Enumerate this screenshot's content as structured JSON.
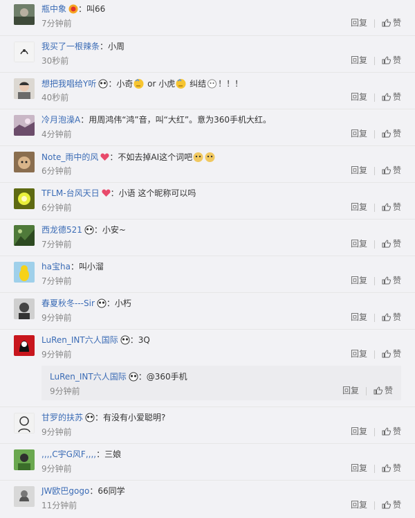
{
  "comments": [
    {
      "user": "瓶中象",
      "badge": "vip",
      "text": "：叫66",
      "time": "7分钟前"
    },
    {
      "user": "我买了一根辣条",
      "badge": "",
      "text": "：小周",
      "time": "30秒前"
    },
    {
      "user": "想把我唱给Y听",
      "badge": "panda",
      "text": "：小奇",
      "text2": " or 小虎",
      "text3": " 纠结",
      "text4": "！！！",
      "time": "40秒前"
    },
    {
      "user": "冷月泡澡A",
      "badge": "",
      "text": "：用周鸿伟“鸿”音，叫“大红”。意为360手机大红。",
      "time": "4分钟前"
    },
    {
      "user": "Note_雨中的风",
      "badge": "heart",
      "text": "：不如去掉AI这个词吧",
      "time": "6分钟前"
    },
    {
      "user": "TFLM-台风天日",
      "badge": "heart",
      "text": "：小语 这个昵称可以吗",
      "time": "6分钟前"
    },
    {
      "user": "西龙德521",
      "badge": "panda",
      "text": "：小安~",
      "time": "7分钟前"
    },
    {
      "user": "ha宝ha",
      "badge": "",
      "text": "：叫小溜",
      "time": "7分钟前"
    },
    {
      "user": "春夏秋冬---Sir",
      "badge": "panda",
      "text": "：小朽",
      "time": "9分钟前"
    },
    {
      "user": "LuRen_INT六人国际",
      "badge": "panda",
      "text": "：3Q",
      "time": "9分钟前"
    },
    {
      "user": "甘罗的扶苏",
      "badge": "panda",
      "text": "：有没有小爱聪明?",
      "time": "9分钟前"
    },
    {
      "user": ",,,,C宇G风F,,,,",
      "badge": "",
      "text": "：三娘",
      "time": "9分钟前"
    },
    {
      "user": "JW欧巴gogo",
      "badge": "",
      "text": "：66同学",
      "time": "11分钟前"
    }
  ],
  "nested_reply": {
    "user": "LuRen_INT六人国际",
    "badge": "panda",
    "text": "：@360手机",
    "time": "9分钟前"
  },
  "actions": {
    "reply": "回复",
    "like": "赞"
  },
  "colors": {
    "username": "#eb7350",
    "link": "#3a6bb5",
    "time": "#888888",
    "background": "#f2f2f5"
  }
}
